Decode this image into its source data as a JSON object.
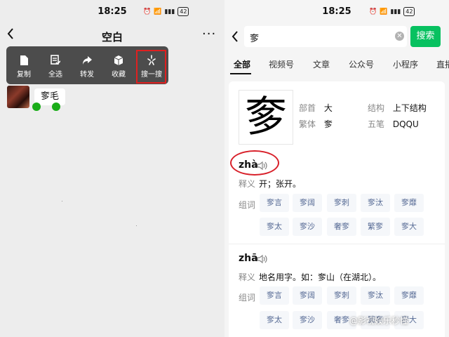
{
  "left": {
    "time": "18:25",
    "battery": "42",
    "title": "空白",
    "more_icon": "···",
    "menu": [
      {
        "label": "复制",
        "icon": "copy-icon"
      },
      {
        "label": "全选",
        "icon": "select-all-icon"
      },
      {
        "label": "转发",
        "icon": "forward-icon"
      },
      {
        "label": "收藏",
        "icon": "favorite-icon"
      },
      {
        "label": "搜一搜",
        "icon": "search-one-icon"
      }
    ],
    "bubble_text": "奓毛"
  },
  "right": {
    "time": "18:25",
    "battery": "42",
    "search_value": "奓",
    "search_button": "搜索",
    "tabs": [
      "全部",
      "视频号",
      "文章",
      "公众号",
      "小程序",
      "直播"
    ],
    "character": "奓",
    "info": {
      "radical_label": "部首",
      "radical": "大",
      "structure_label": "结构",
      "structure": "上下结构",
      "traditional_label": "繁体",
      "traditional": "奓",
      "wubi_label": "五笔",
      "wubi": "DQQU"
    },
    "readings": [
      {
        "pinyin": "zhà",
        "meaning_label": "释义",
        "meaning": "开；张开。",
        "words_label": "组词",
        "words": [
          "奓言",
          "奓阔",
          "奓刺",
          "奓汰",
          "奓靡",
          "奓太",
          "奓沙",
          "奢奓",
          "繁奓",
          "奓大"
        ]
      },
      {
        "pinyin": "zhā",
        "meaning_label": "释义",
        "meaning": "地名用字。如：奓山（在湖北）。",
        "words_label": "组词",
        "words": [
          "奓言",
          "奓阔",
          "奓刺",
          "奓汰",
          "奓靡",
          "奓太",
          "奓沙",
          "奢奓",
          "繁奓",
          "奓大"
        ]
      }
    ],
    "watermark": "@影视娱乐秒懂"
  },
  "colors": {
    "accent_green": "#07c160",
    "link_blue": "#576b95",
    "highlight_red": "#e02020",
    "menu_bg": "#4c4c4c"
  }
}
